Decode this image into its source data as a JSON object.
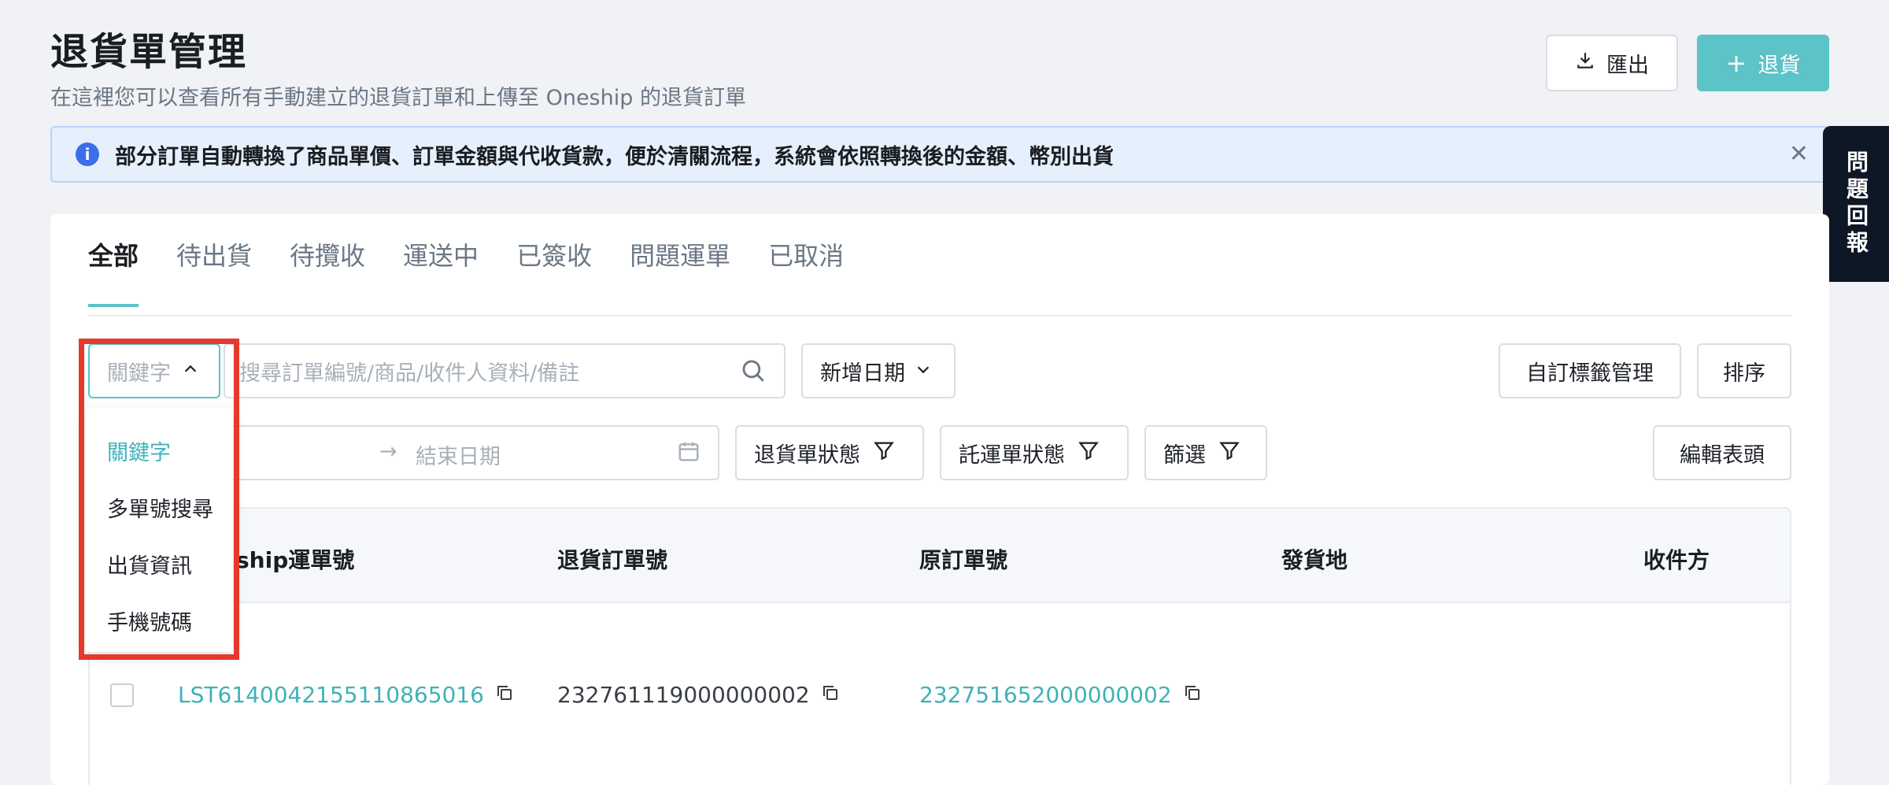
{
  "header": {
    "title": "退貨單管理",
    "subtitle": "在這裡您可以查看所有手動建立的退貨訂單和上傳至 Oneship 的退貨訂單",
    "export_label": "匯出",
    "return_label": "退貨"
  },
  "notice": {
    "text": "部分訂單自動轉換了商品單價、訂單金額與代收貨款，便於清關流程，系統會依照轉換後的金額、幣別出貨"
  },
  "feedback_label": "問題回報",
  "tabs": [
    {
      "label": "全部"
    },
    {
      "label": "待出貨"
    },
    {
      "label": "待攬收"
    },
    {
      "label": "運送中"
    },
    {
      "label": "已簽收"
    },
    {
      "label": "問題運單"
    },
    {
      "label": "已取消"
    }
  ],
  "search": {
    "type_label": "關鍵字",
    "placeholder": "搜尋訂單編號/商品/收件人資料/備註",
    "date_select": "新增日期",
    "end_date_placeholder": "結束日期"
  },
  "toolbar": {
    "tag_manage": "自訂標籤管理",
    "sort": "排序",
    "edit_columns": "編輯表頭",
    "return_status": "退貨單狀態",
    "waybill_status": "託運單狀態",
    "filter": "篩選"
  },
  "dropdown": {
    "items": [
      "關鍵字",
      "多單號搜尋",
      "出貨資訊",
      "手機號碼"
    ]
  },
  "table": {
    "headers": [
      "ship運單號",
      "退貨訂單號",
      "原訂單號",
      "發貨地",
      "收件方"
    ],
    "rows": [
      {
        "waybill": "LST614004215511086501​6",
        "return_order": "232761119000000002",
        "original_order": "232751652000000002"
      }
    ]
  },
  "colors": {
    "accent": "#5cc3c8",
    "link": "#3fb2b8",
    "highlight": "#e5392b"
  }
}
